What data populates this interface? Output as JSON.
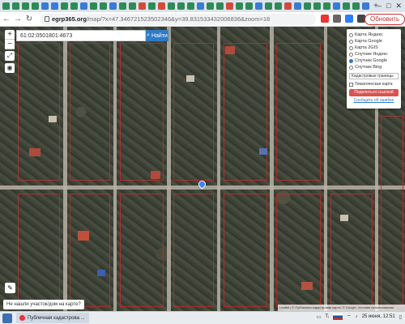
{
  "browser": {
    "url_host": "egrp365.org",
    "url_path": "/map/?x=47.346721523502346&y=39.831533432006836&zoom=18",
    "update_label": "Обновить",
    "update_menu": "⋮"
  },
  "map": {
    "search_value": "61:02:0501801:4673",
    "search_button": "Найти",
    "zoom_in": "+",
    "zoom_out": "−",
    "fullscreen": "⤢",
    "locate": "◉",
    "layers": [
      {
        "label": "Карта Яндекс",
        "selected": false
      },
      {
        "label": "Карта Google",
        "selected": false
      },
      {
        "label": "Карта 2GIS",
        "selected": false
      },
      {
        "label": "Спутник Яндекс",
        "selected": false
      },
      {
        "label": "Спутник Google",
        "selected": true
      },
      {
        "label": "Спутник Bing",
        "selected": false
      }
    ],
    "cadastral_select": "Кадастровые границы",
    "thematic_label": "Тематическая карта",
    "share_button": "Поделиться ссылкой",
    "report_link": "Сообщить об ошибке",
    "not_found": "Не нашли участок/дом на карте?",
    "attribution": "Leaflet | © Публичная кадастровая карта, © Google, Условия использования"
  },
  "taskbar": {
    "window_title": "Публичная кадастрова ...",
    "clock": "25 июня, 12:51"
  }
}
